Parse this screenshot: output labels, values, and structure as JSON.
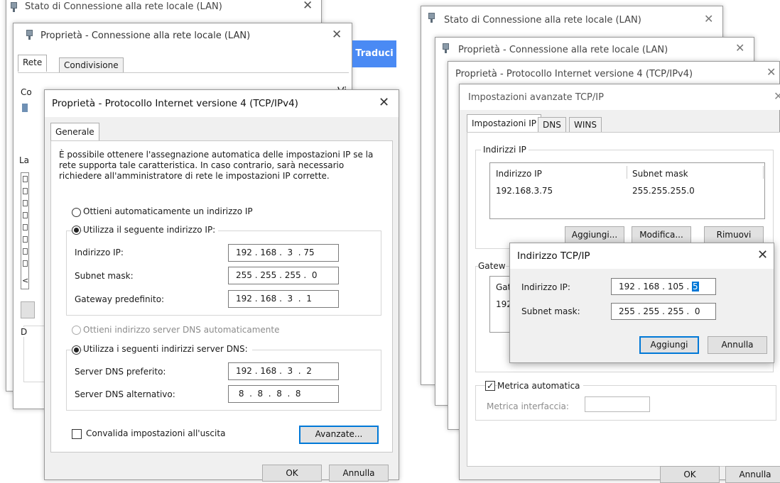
{
  "left": {
    "back_window_title": "Stato di Connessione alla rete locale (LAN)",
    "props_title": "Proprietà - Connessione alla rete locale (LAN)",
    "props_tabs": [
      "Rete",
      "Condivisione"
    ],
    "props_partial_conn": "Co",
    "props_partial_la": "La",
    "props_partial_vi": "Vi",
    "props_partial_d": "D",
    "props_partial_arrow": "<",
    "translate_button": "Traduci",
    "tcp_title": "Proprietà - Protocollo Internet versione 4 (TCP/IPv4)",
    "tcp_tab": "Generale",
    "description": [
      "È possibile ottenere l'assegnazione automatica delle impostazioni IP se la",
      "rete supporta tale caratteristica. In caso contrario, sarà necessario",
      "richiedere all'amministratore di rete le impostazioni IP corrette."
    ],
    "radio_auto_ip": "Ottieni automaticamente un indirizzo IP",
    "radio_manual_ip": "Utilizza il seguente indirizzo IP:",
    "ip_label": "Indirizzo IP:",
    "ip_value": "192 . 168 .  3  . 75",
    "mask_label": "Subnet mask:",
    "mask_value": "255 . 255 . 255 .  0",
    "gateway_label": "Gateway predefinito:",
    "gateway_value": "192 . 168 .  3  .  1",
    "radio_auto_dns": "Ottieni indirizzo server DNS automaticamente",
    "radio_manual_dns": "Utilizza i seguenti indirizzi server DNS:",
    "dns_pref_label": "Server DNS preferito:",
    "dns_pref_value": "192 . 168 .  3  .  2",
    "dns_alt_label": "Server DNS alternativo:",
    "dns_alt_value": " 8  .  8  .  8  .  8",
    "validate_label": "Convalida impostazioni all'uscita",
    "advanced_button": "Avanzate...",
    "ok_button": "OK",
    "cancel_button": "Annulla"
  },
  "right": {
    "status_title": "Stato di Connessione alla rete locale (LAN)",
    "props_title": "Proprietà - Connessione alla rete locale (LAN)",
    "tcp_title": "Proprietà - Protocollo Internet versione 4 (TCP/IPv4)",
    "adv_title": "Impostazioni avanzate TCP/IP",
    "adv_tabs": [
      "Impostazioni IP",
      "DNS",
      "WINS"
    ],
    "ip_group_label": "Indirizzi IP",
    "col_ip": "Indirizzo IP",
    "col_mask": "Subnet mask",
    "row_ip": "192.168.3.75",
    "row_mask": "255.255.255.0",
    "add_button": "Aggiungi...",
    "edit_button": "Modifica...",
    "remove_button": "Rimuovi",
    "gateway_group_partial": "Gatew",
    "gateway_col_partial": "Gat",
    "gateway_row_partial": "192",
    "metric_auto": "Metrica automatica",
    "metric_iface": "Metrica interfaccia:",
    "ok_button": "OK",
    "cancel_button": "Annulla",
    "dialog_title": "Indirizzo TCP/IP",
    "dialog_ip_label": "Indirizzo IP:",
    "dialog_ip_prefix": "192 . 168 . 105 . ",
    "dialog_ip_selected": "5",
    "dialog_mask_label": "Subnet mask:",
    "dialog_mask_value": "255 . 255 . 255 .  0",
    "dialog_add_button": "Aggiungi",
    "dialog_cancel_button": "Annulla"
  }
}
